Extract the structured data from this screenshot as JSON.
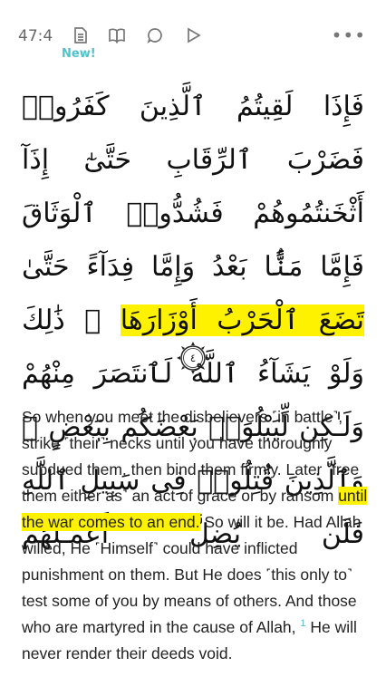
{
  "toolbar": {
    "verse_key": "47:4",
    "new_badge": "New!",
    "icons": [
      "document-icon",
      "book-icon",
      "comment-icon",
      "play-icon",
      "more-icon"
    ],
    "more_label": "•••"
  },
  "ayah": {
    "arabic_part1": "فَإِذَا لَقِيتُمُ ٱلَّذِينَ كَفَرُوا۟ فَضَرْبَ ٱلرِّقَابِ حَتَّىٰٓ إِذَآ أَثْخَنتُمُوهُمْ فَشُدُّوا۟ ٱلْوَثَاقَ فَإِمَّا مَنًّۢا بَعْدُ وَإِمَّا فِدَآءً حَتَّىٰ ",
    "arabic_highlight": "تَضَعَ ٱلْحَرْبُ أَوْزَارَهَا",
    "arabic_part2": " ۚ ذَٰلِكَ وَلَوْ يَشَآءُ ٱللَّهُ لَٱنتَصَرَ مِنْهُمْ وَلَـٰكِن لِّيَبْلُوَا۟ بَعْضَكُم بِبَعْضٍ ۗ وَٱلَّذِينَ قُتِلُوا۟ فِى سَبِيلِ ٱللَّهِ فَلَن يُضِلَّ أَعْمَـٰلَهُمْ",
    "number": "٤"
  },
  "translation": {
    "part1": "So when you meet the disbelievers ˹in battle˺, strike ˹their˺ necks until you have thoroughly subdued them, then bind them firmly. Later ˹free them either as˺ an act of grace or by ransom ",
    "highlight": "until the war comes to an end.",
    "part2": " So will it be. Had Allah willed, He ˹Himself˺ could have inflicted punishment on them. But He does ˹this only to˺ test some of you by means of others. And those who are martyred in the cause of Allah, ",
    "footnote": "1",
    "part3": " He will never render their deeds void."
  },
  "colors": {
    "highlight": "#fff200",
    "accent": "#4ec3c9"
  }
}
